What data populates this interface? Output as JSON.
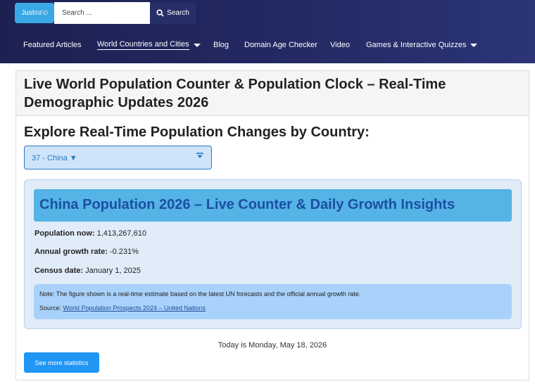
{
  "header": {
    "logo_text_main": "Just",
    "logo_text_accent": "INFO",
    "search": {
      "placeholder": "Search ...",
      "button_label": "Search"
    },
    "nav": [
      {
        "label": "Featured Articles"
      },
      {
        "label": "World Countries and Cities"
      },
      {
        "label": "Blog"
      },
      {
        "label": "Domain Age Checker"
      },
      {
        "label": "Video"
      },
      {
        "label": "Games & Interactive Quizzes"
      }
    ]
  },
  "main": {
    "page_title": "Live World Population Counter & Population Clock – Real-Time Demographic Updates 2026",
    "section_title": "Explore Real-Time Population Changes by Country:",
    "country_select": {
      "selected": "37 - China ▼"
    },
    "info": {
      "heading": "China Population 2026 – Live Counter & Daily Growth Insights",
      "population_label": "Population now:",
      "population_value": "1,413,267,610",
      "growth_label": "Annual growth rate:",
      "growth_value": "-0.231%",
      "census_label": "Census date:",
      "census_value": "January 1, 2025",
      "note": "Note: The figure shown is a real-time estimate based on the latest UN forecasts and the official annual growth rate.",
      "source_label": "Source:",
      "source_link": "World Population Prospects 2024 – United Nations"
    },
    "today": "Today is Monday, May 18, 2026",
    "more_button": "See more statistics"
  },
  "colors": {
    "header_bg": "#232a63",
    "accent": "#2196f3",
    "heading_bar": "#55b3e6",
    "heading_text": "#1b4fa3"
  }
}
